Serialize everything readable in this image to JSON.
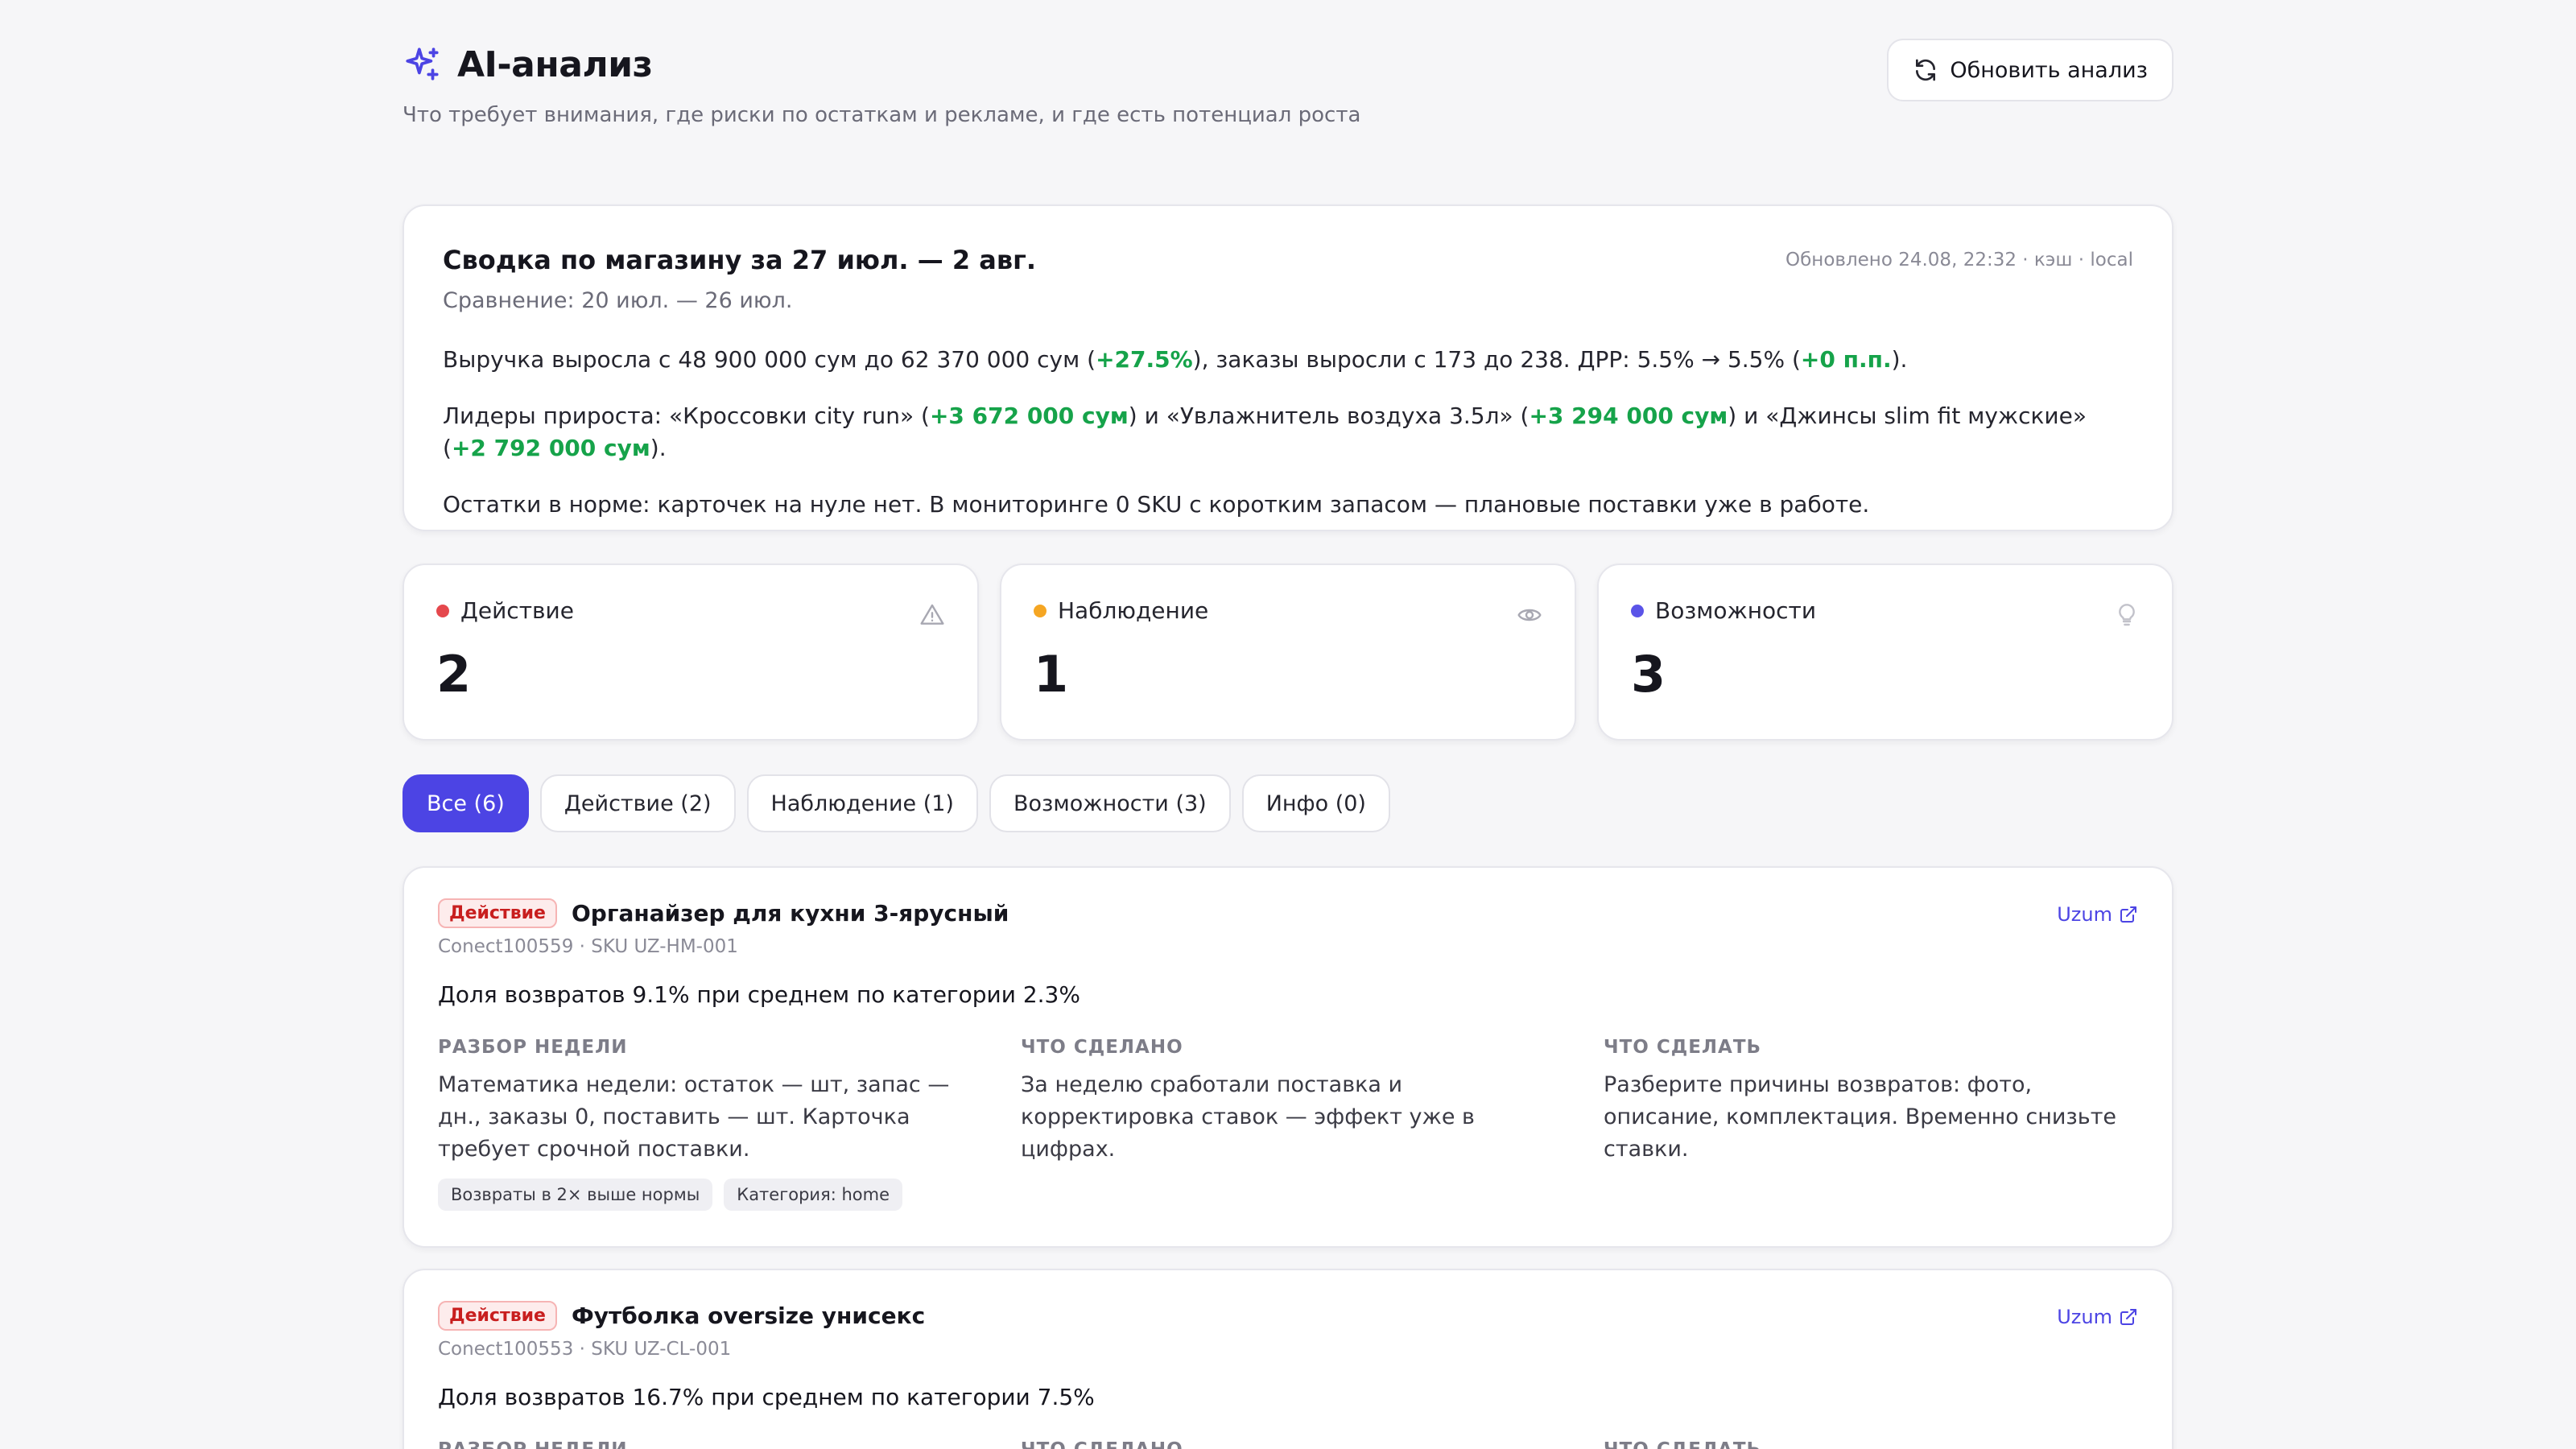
{
  "header": {
    "title": "AI-анализ",
    "subtitle": "Что требует внимания, где риски по остаткам и рекламе, и где есть потенциал роста",
    "refresh_label": "Обновить анализ"
  },
  "summary": {
    "title": "Сводка по магазину за 27 июл. — 2 авг.",
    "compare": "Сравнение: 20 июл. — 26 июл.",
    "meta": "Обновлено 24.08, 22:32 · кэш · local",
    "line1": {
      "a": "Выручка выросла с 48 900 000 сум до 62 370 000 сум (",
      "b": "+27.5%",
      "c": "), заказы выросли с 173 до 238. ДРР: 5.5% → 5.5% (",
      "d": "+0 п.п.",
      "e": ")."
    },
    "line2": {
      "a": "Лидеры прироста: «Кроссовки city run» (",
      "b": "+3 672 000 сум",
      "c": ") и «Увлажнитель воздуха 3.5л» (",
      "d": "+3 294 000 сум",
      "e": ") и «Джинсы slim fit мужские» (",
      "f": "+2 792 000 сум",
      "g": ")."
    },
    "line3": "Остатки в норме: карточек на нуле нет. В мониторинге 0 SKU с коротким запасом — плановые поставки уже в работе."
  },
  "stats": [
    {
      "label": "Действие",
      "value": "2",
      "color": "#e5484d",
      "icon": "warning-icon"
    },
    {
      "label": "Наблюдение",
      "value": "1",
      "color": "#f5a623",
      "icon": "eye-icon"
    },
    {
      "label": "Возможности",
      "value": "3",
      "color": "#5b54e8",
      "icon": "lightbulb-icon"
    }
  ],
  "tabs": [
    {
      "label": "Все (6)",
      "active": true
    },
    {
      "label": "Действие (2)"
    },
    {
      "label": "Наблюдение (1)"
    },
    {
      "label": "Возможности (3)"
    },
    {
      "label": "Инфо (0)"
    }
  ],
  "insights": [
    {
      "badge": "Действие",
      "title": "Органайзер для кухни 3-ярусный",
      "sub": "Conect100559 · SKU UZ-HM-001",
      "link": "Uzum",
      "metric": "Доля возвратов 9.1% при среднем по категории 2.3%",
      "col1_label": "Разбор недели",
      "col1_text": "Математика недели: остаток — шт, запас — дн., заказы 0, поставить — шт. Карточка требует срочной поставки.",
      "col2_label": "Что сделано",
      "col2_text": "За неделю сработали поставка и корректировка ставок — эффект уже в цифрах.",
      "col3_label": "Что сделать",
      "col3_text": "Разберите причины возвратов: фото, описание, комплектация. Временно снизьте ставки.",
      "tags": [
        "Возвраты в 2× выше нормы",
        "Категория: home"
      ]
    },
    {
      "badge": "Действие",
      "title": "Футболка oversize унисекс",
      "sub": "Conect100553 · SKU UZ-CL-001",
      "link": "Uzum",
      "metric": "Доля возвратов 16.7% при среднем по категории 7.5%",
      "col1_label": "Разбор недели",
      "col2_label": "Что сделано",
      "col3_label": "Что сделать"
    }
  ],
  "colors": {
    "accent": "#4c44e4",
    "positive": "#16a34a",
    "danger": "#c81e1e"
  }
}
